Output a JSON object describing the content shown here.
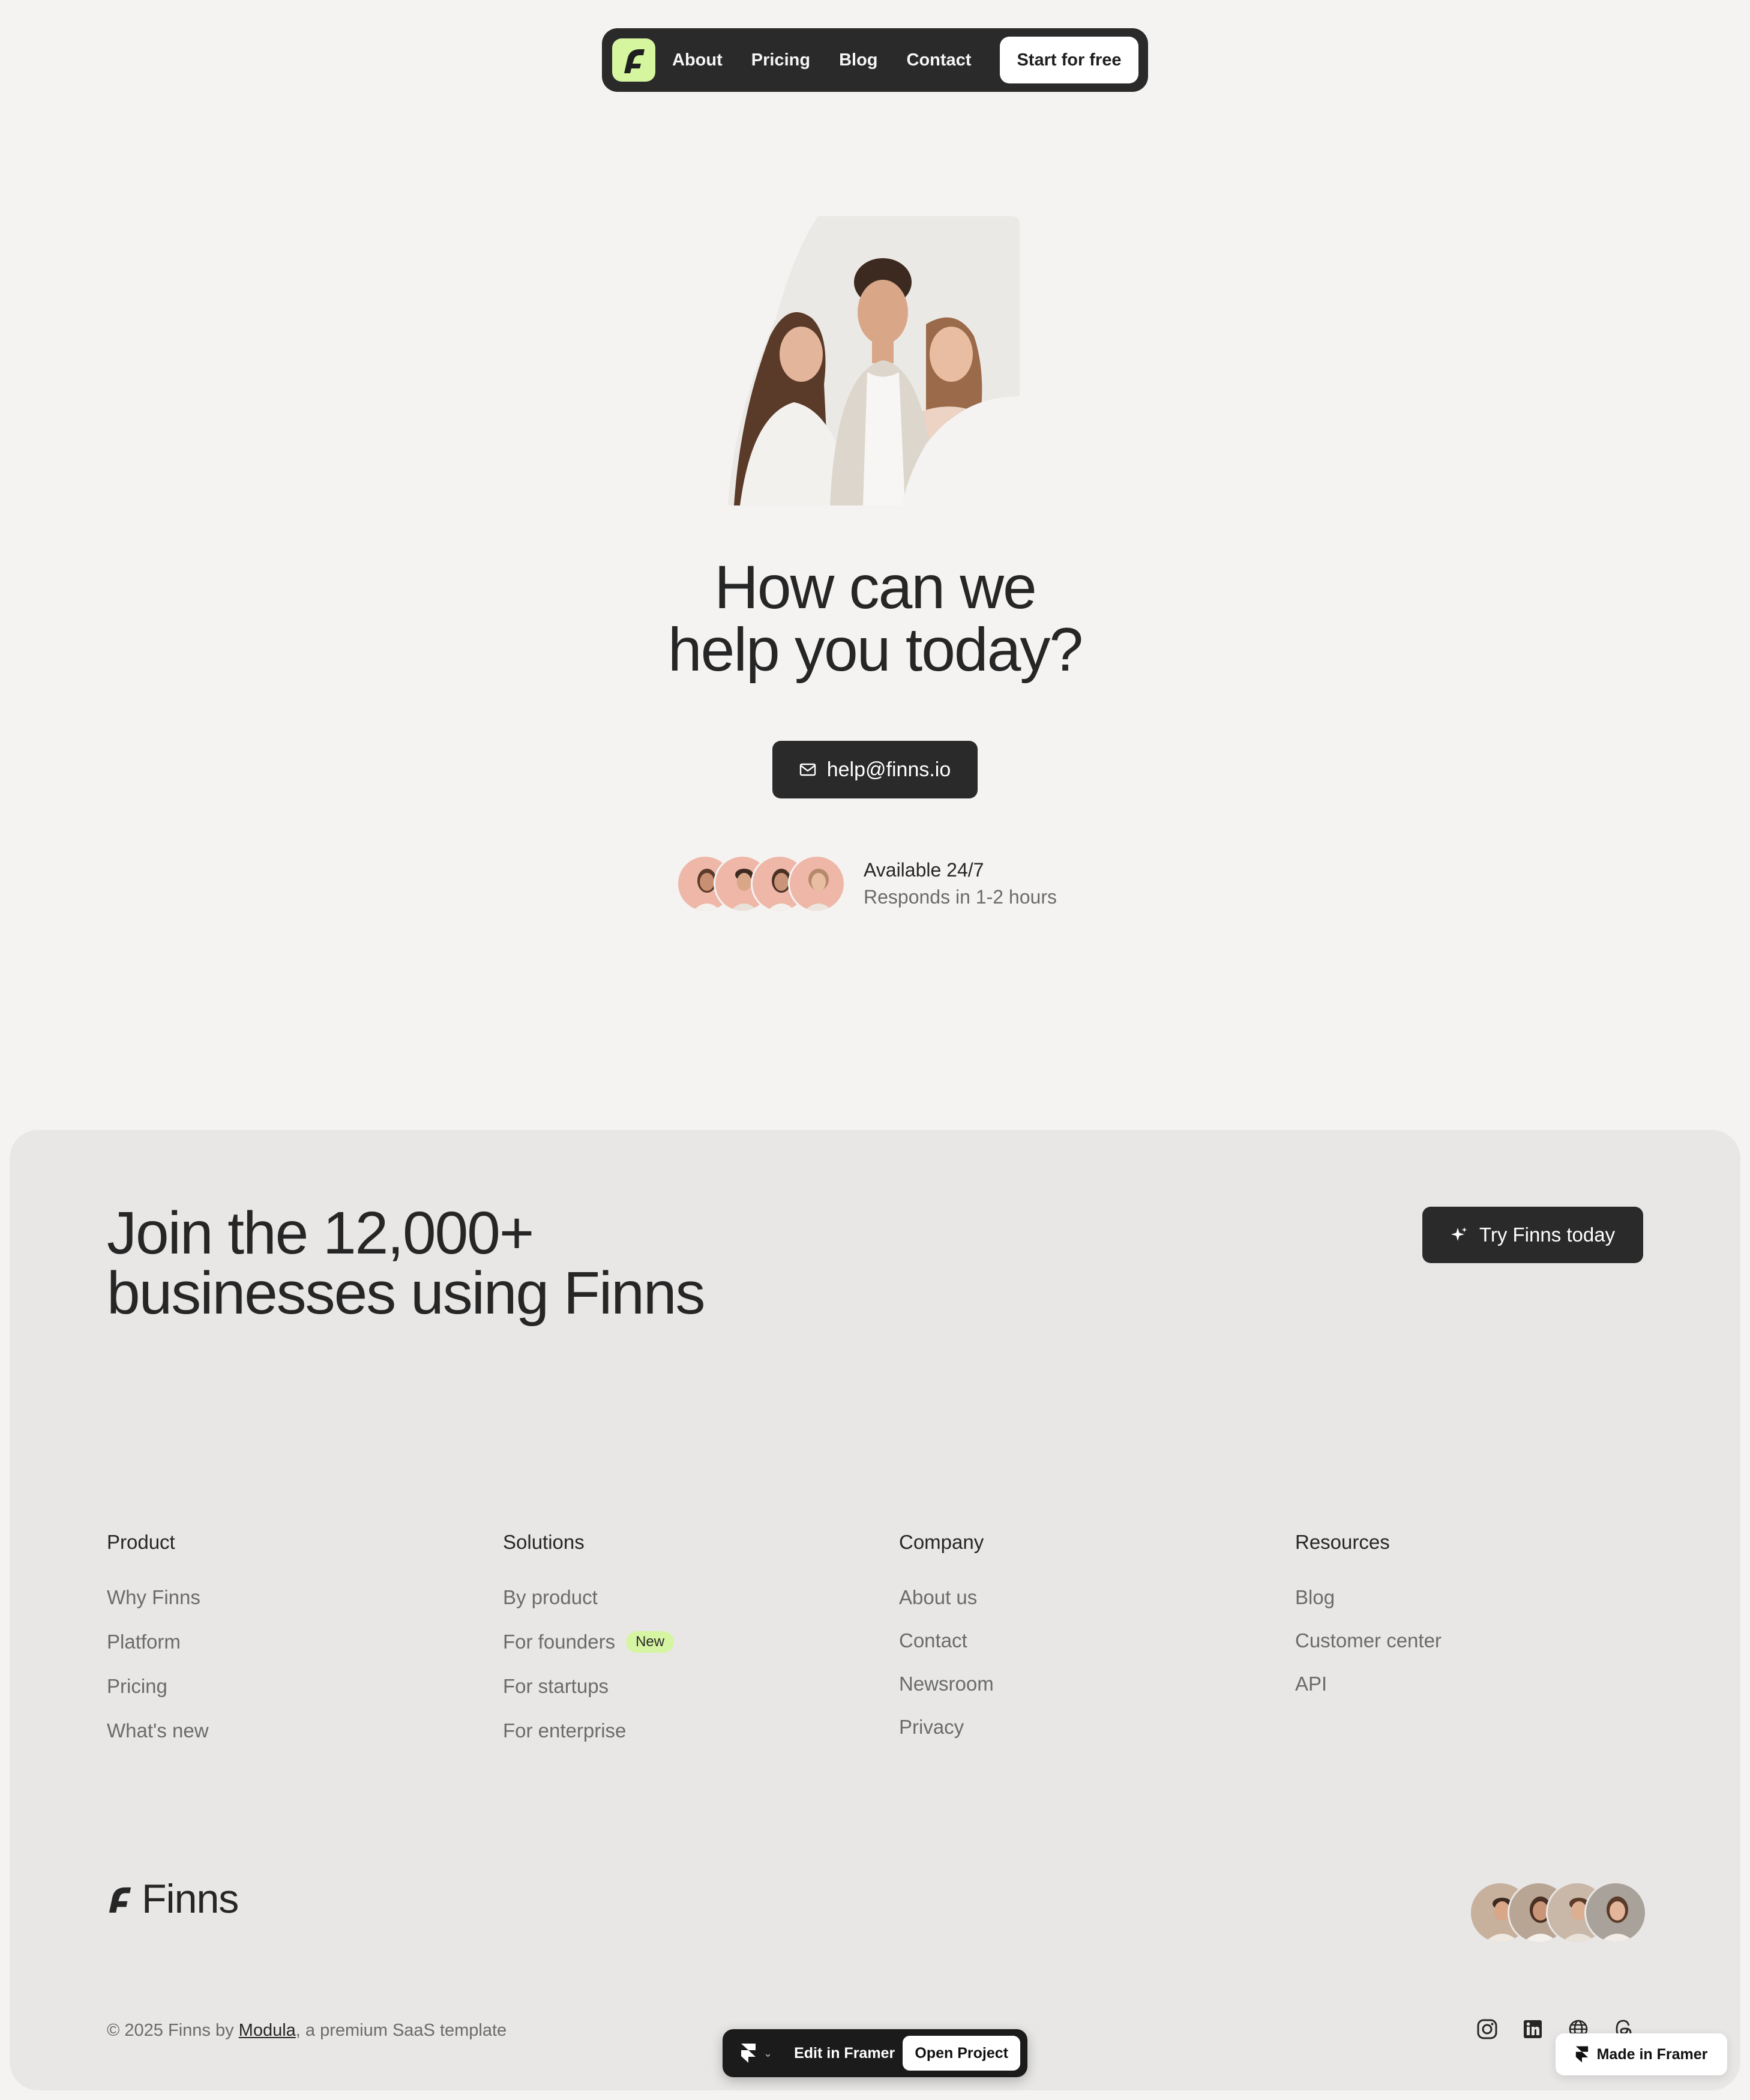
{
  "nav": {
    "links": [
      "About",
      "Pricing",
      "Blog",
      "Contact"
    ],
    "cta": "Start for free"
  },
  "hero": {
    "title_line1": "How can we",
    "title_line2": "help you today?",
    "email": "help@finns.io",
    "availability_title": "Available 24/7",
    "availability_sub": "Responds in 1-2 hours"
  },
  "footer": {
    "join_line1": "Join the 12,000+",
    "join_line2": "businesses using Finns",
    "try_button": "Try Finns today",
    "columns": [
      {
        "heading": "Product",
        "links": [
          "Why Finns",
          "Platform",
          "Pricing",
          "What's new"
        ]
      },
      {
        "heading": "Solutions",
        "links": [
          "By product",
          "For founders",
          "For startups",
          "For enterprise"
        ],
        "badge": "New"
      },
      {
        "heading": "Company",
        "links": [
          "About us",
          "Contact",
          "Newsroom",
          "Privacy"
        ]
      },
      {
        "heading": "Resources",
        "links": [
          "Blog",
          "Customer center",
          "API"
        ]
      }
    ],
    "brand": "Finns",
    "copyright_prefix": "© 2025 Finns by ",
    "copyright_link": "Modula",
    "copyright_suffix": ", a premium SaaS template",
    "socials": [
      "instagram-icon",
      "linkedin-icon",
      "globe-icon",
      "threads-icon"
    ]
  },
  "framer": {
    "edit": "Edit in Framer",
    "open": "Open Project",
    "made_in": "Made in Framer"
  },
  "colors": {
    "page_bg": "#f4f3f2",
    "footer_bg": "#e8e7e6",
    "dark": "#2a2a2b",
    "logo_green": "#d5f59e",
    "badge_green": "#d6f5a2"
  }
}
